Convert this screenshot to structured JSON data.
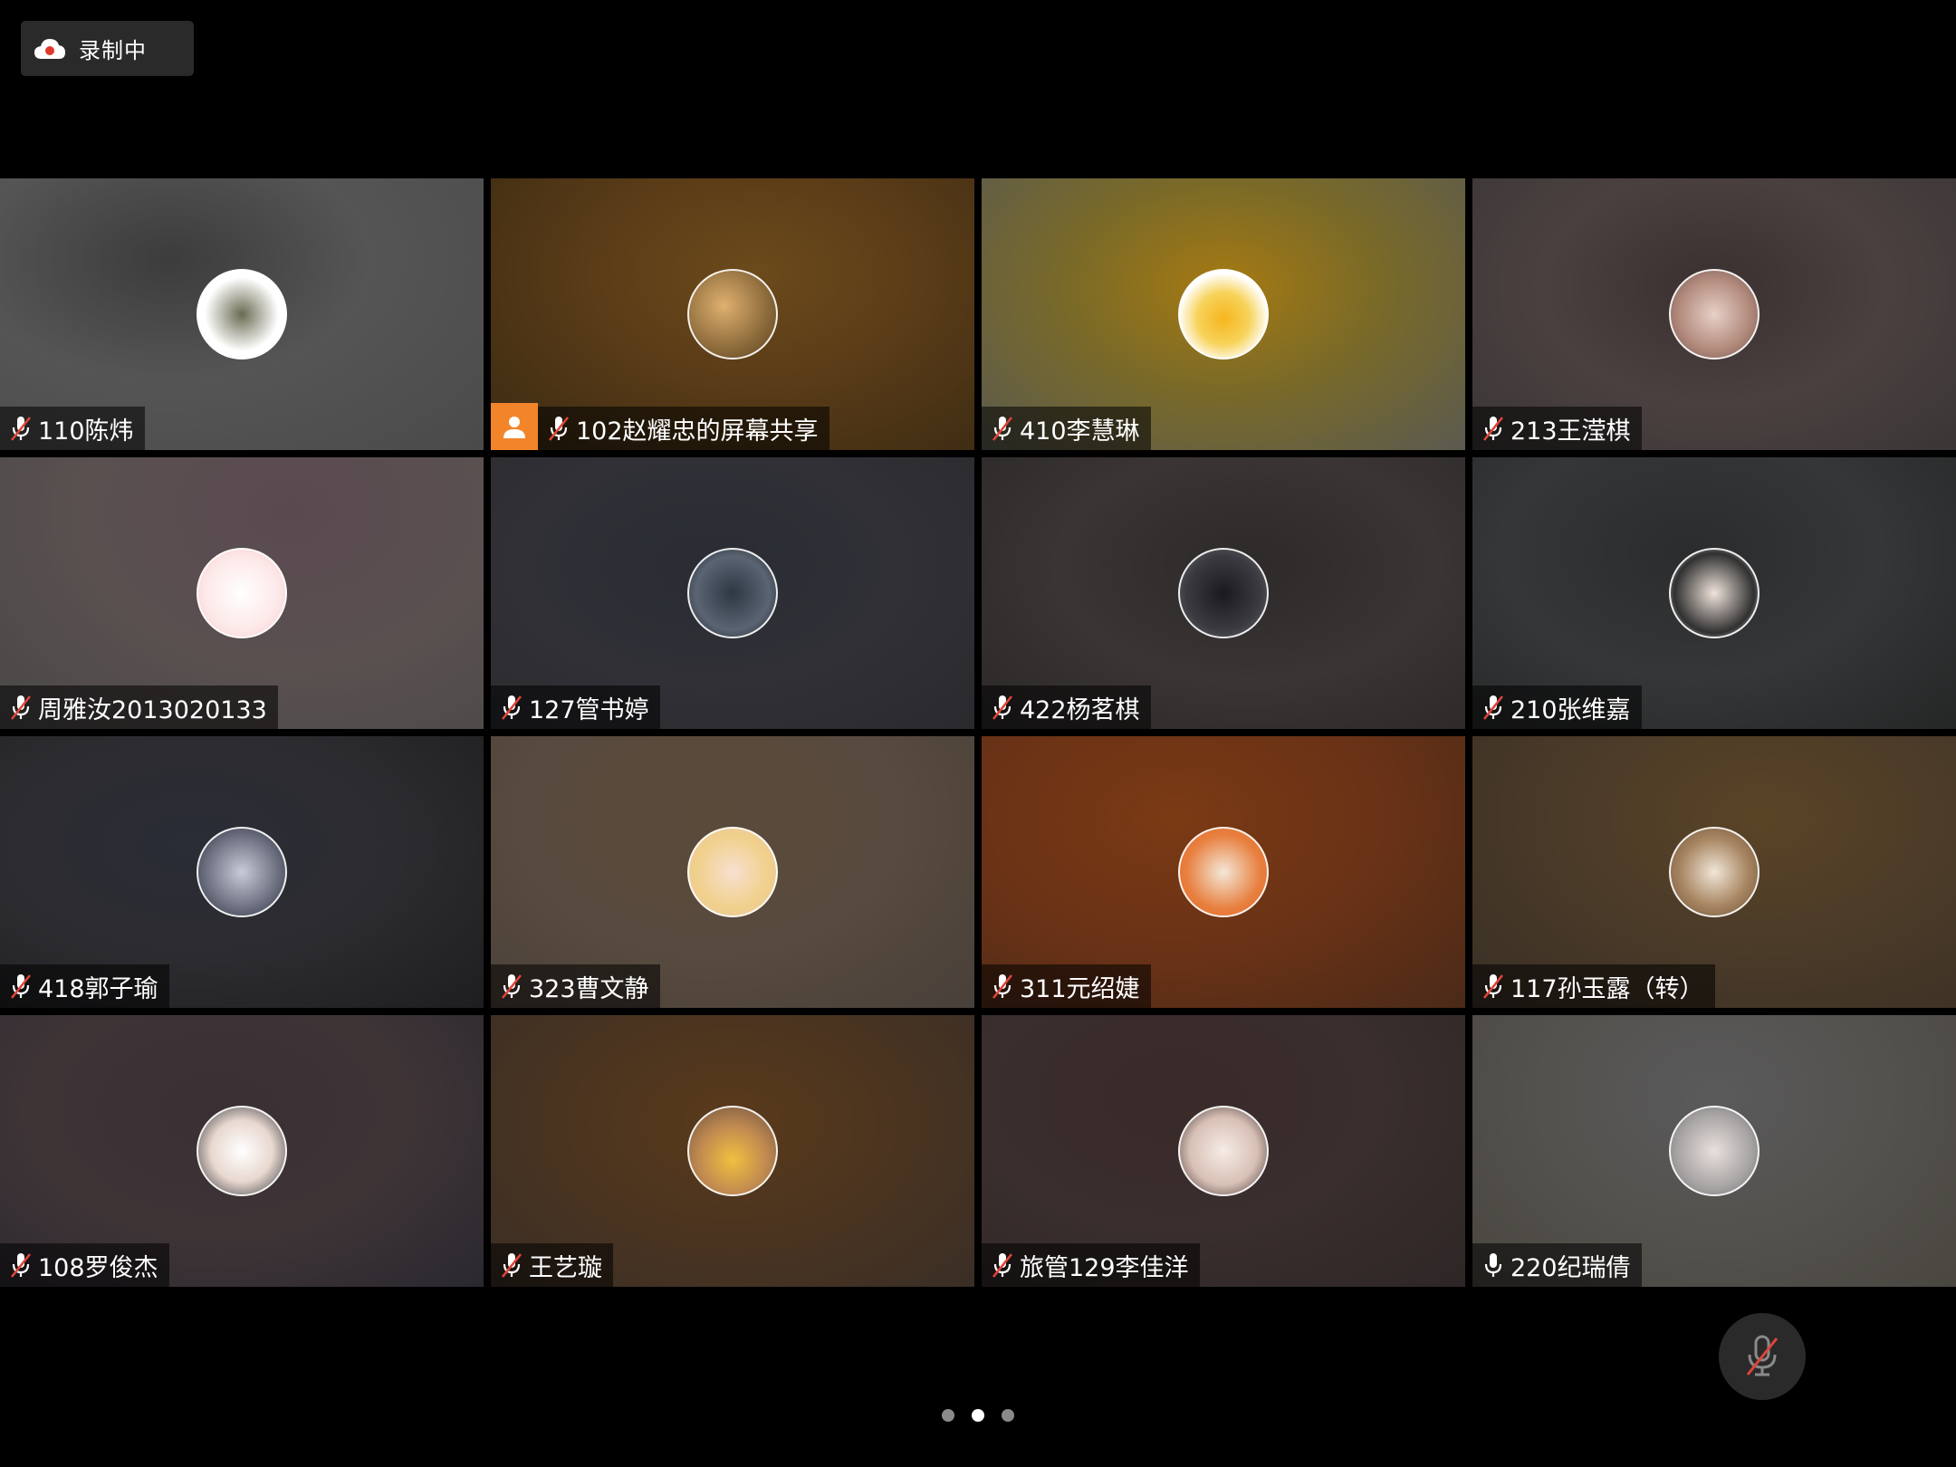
{
  "recording": {
    "label": "录制中"
  },
  "tiles": [
    {
      "name": "110陈炜",
      "muted": true,
      "bg": "radial-gradient(ellipse at 35% 30%, #3c3c3c 0%, #555 45%, #4a4a4a 100%)",
      "avatar_bg": "radial-gradient(circle at 50% 50%, #6a6a52 0%, #ffffff 60%)"
    },
    {
      "name": "102赵耀忠的屏幕共享",
      "muted": true,
      "share": true,
      "bg": "radial-gradient(ellipse at 55% 35%, #6b4a1a 0%, #5c3d18 40%, #3a2a12 100%)",
      "avatar_bg": "radial-gradient(circle at 40% 40%, #e0b070 0%, #8b6a3a 60%, #5a4020 100%)"
    },
    {
      "name": "410李慧琳",
      "muted": true,
      "bg": "radial-gradient(ellipse at 50% 40%, #a67a12 0%, #7a6a28 45%, #5a5a50 100%)",
      "avatar_bg": "radial-gradient(circle at 50% 55%, #f7b51f 0%, #f7d35a 40%, #ffffff 70%)"
    },
    {
      "name": "213王滢棋",
      "muted": true,
      "bg": "radial-gradient(ellipse at 50% 40%, #3a3030 0%, #4b4040 50%, #3a3636 100%)",
      "avatar_bg": "radial-gradient(circle at 50% 50%, #e8d0c8 0%, #b0887a 60%, #6a5050 100%)"
    },
    {
      "name": "周雅汝2013020133",
      "muted": true,
      "bg": "radial-gradient(ellipse at 60% 20%, #5a4a50 0%, #5a5050 50%, #4a4848 100%)",
      "avatar_bg": "radial-gradient(circle at 50% 50%, #ffffff 0%, #fde8e8 60%, #f7c6cc 100%)"
    },
    {
      "name": "127管书婷",
      "muted": true,
      "bg": "radial-gradient(ellipse at 45% 40%, #2a2c34 0%, #303036 50%, #2a2a2e 100%)",
      "avatar_bg": "radial-gradient(circle at 50% 50%, #2e3844 0%, #5a6472 60%, #1e2228 100%)"
    },
    {
      "name": "422杨茗棋",
      "muted": true,
      "bg": "radial-gradient(ellipse at 55% 40%, #2e2a2a 0%, #3a3434 50%, #2c2828 100%)",
      "avatar_bg": "radial-gradient(circle at 50% 50%, #1a1a1e 0%, #3a3a40 60%, #6a6a70 100%)"
    },
    {
      "name": "210张维嘉",
      "muted": true,
      "bg": "radial-gradient(ellipse at 45% 35%, #2a2c2e 0%, #343638 50%, #252626 100%)",
      "avatar_bg": "radial-gradient(circle at 50% 50%, #f0e4dc 0%, #303030 65%, #ffffff 100%)"
    },
    {
      "name": "418郭子瑜",
      "muted": true,
      "bg": "radial-gradient(ellipse at 40% 40%, #2a2c36 0%, #2c2c30 50%, #1e1e20 100%)",
      "avatar_bg": "radial-gradient(circle at 50% 50%, #c8ccd8 0%, #6a6e7e 60%, #2a2c36 100%)"
    },
    {
      "name": "323曹文静",
      "muted": true,
      "bg": "radial-gradient(ellipse at 45% 30%, #5a4a3a 0%, #584a3e 50%, #48403a 100%)",
      "avatar_bg": "radial-gradient(circle at 50% 50%, #f8e0d0 0%, #f0d08a 60%, #e8c6b0 100%)"
    },
    {
      "name": "311元绍婕",
      "muted": true,
      "bg": "radial-gradient(ellipse at 40% 30%, #7a3a14 0%, #6a3216 50%, #4a2a18 100%)",
      "avatar_bg": "radial-gradient(circle at 50% 50%, #f4e8d8 0%, #e88040 60%, #e06a2a 100%)"
    },
    {
      "name": "117孙玉露（转）",
      "muted": true,
      "bg": "radial-gradient(ellipse at 60% 30%, #5a4426 0%, #4a3a28 50%, #3a3026 100%)",
      "avatar_bg": "radial-gradient(circle at 50% 50%, #f0e6d8 0%, #a88662 55%, #6a5038 100%)"
    },
    {
      "name": "108罗俊杰",
      "muted": true,
      "bg": "radial-gradient(ellipse at 45% 35%, #3a3034 0%, #3e3436 50%, #2a2830 100%)",
      "avatar_bg": "radial-gradient(circle at 50% 50%, #ffffff 0%, #e8d8d0 50%, #2a2a30 100%)"
    },
    {
      "name": "王艺璇",
      "muted": true,
      "bg": "radial-gradient(ellipse at 50% 40%, #5a3a1a 0%, #4a3420 50%, #3a2e26 100%)",
      "avatar_bg": "radial-gradient(circle at 50% 60%, #f0c040 0%, #c08a50 50%, #6a5040 100%)"
    },
    {
      "name": "旅管129李佳洋",
      "muted": true,
      "bg": "radial-gradient(ellipse at 40% 30%, #3a2a2a 0%, #3a2e2e 50%, #2e2626 100%)",
      "avatar_bg": "radial-gradient(circle at 50% 50%, #f6ece6 0%, #d8c0b6 55%, #3a3030 100%)"
    },
    {
      "name": "220纪瑞倩",
      "muted": false,
      "bg": "radial-gradient(ellipse at 50% 30%, #5a5a5c 0%, #54524e 50%, #4a4640 100%)",
      "avatar_bg": "radial-gradient(circle at 50% 50%, #e8e0dc 0%, #a8a4a4 60%, #6a6a6e 100%)"
    }
  ],
  "pager": {
    "count": 3,
    "active": 1
  },
  "icons": {
    "recording": "cloud-record-icon",
    "mic_muted": "mic-muted-icon",
    "mic_on": "mic-icon",
    "share": "person-share-icon",
    "mute_fab": "mic-muted-icon"
  },
  "colors": {
    "background": "#000000",
    "share_accent": "#f2852a",
    "record_dot": "#e03a2a",
    "mute_slash": "#e0453a"
  }
}
